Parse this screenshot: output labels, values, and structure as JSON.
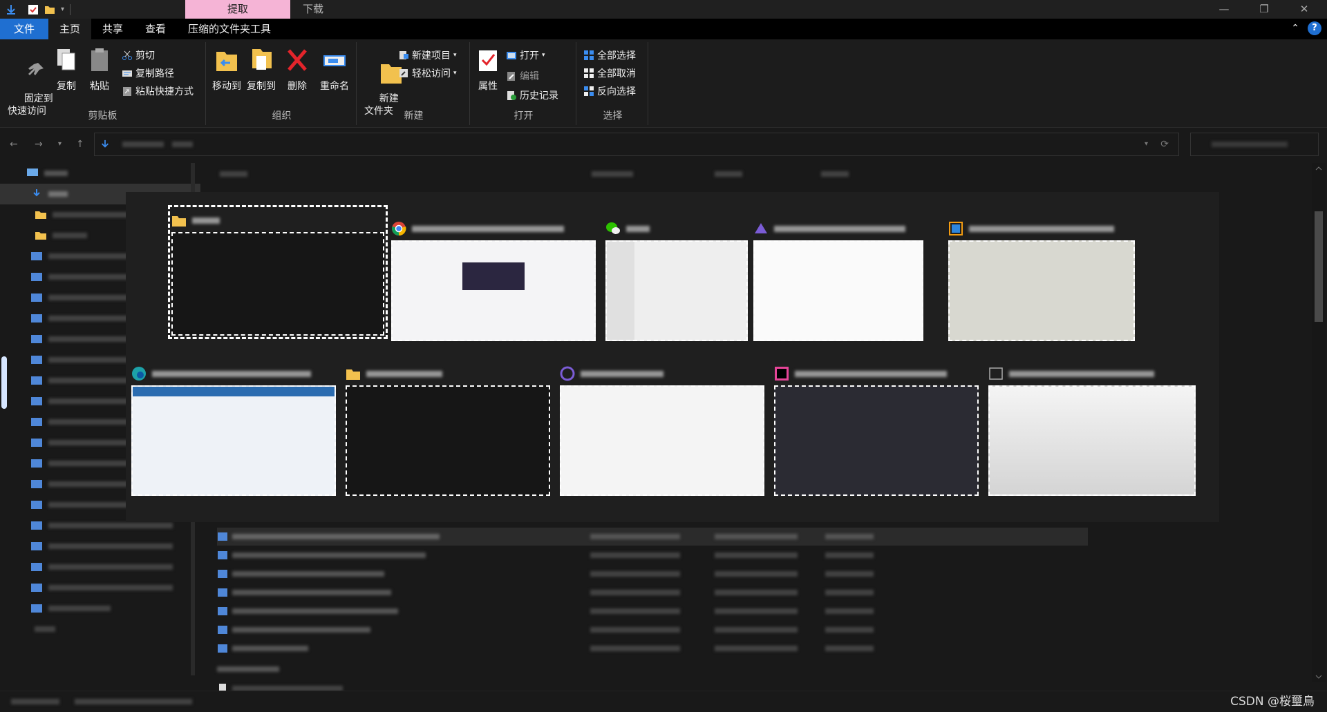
{
  "titlebar": {
    "context_tab": "提取",
    "window_title": "下载",
    "minimize": "—",
    "restore": "❐",
    "close": "✕"
  },
  "menubar": {
    "file": "文件",
    "tabs": [
      "主页",
      "共享",
      "查看",
      "压缩的文件夹工具"
    ],
    "help": "?"
  },
  "ribbon": {
    "clipboard": {
      "label": "剪贴板",
      "pin": "固定到\n快速访问",
      "copy": "复制",
      "paste": "粘贴",
      "cut": "剪切",
      "copy_path": "复制路径",
      "paste_shortcut": "粘贴快捷方式"
    },
    "organize": {
      "label": "组织",
      "move_to": "移动到",
      "copy_to": "复制到",
      "delete": "删除",
      "rename": "重命名"
    },
    "new": {
      "label": "新建",
      "new_folder": "新建\n文件夹",
      "new_item": "新建项目",
      "easy_access": "轻松访问"
    },
    "open": {
      "label": "打开",
      "properties": "属性",
      "open": "打开",
      "edit": "编辑",
      "history": "历史记录"
    },
    "select": {
      "label": "选择",
      "select_all": "全部选择",
      "select_none": "全部取消",
      "invert": "反向选择"
    }
  },
  "watermark": "CSDN @桜璽鳥",
  "colors": {
    "accent": "#1f6fd1",
    "context_tab": "#f5b4d6",
    "background": "#191919"
  }
}
